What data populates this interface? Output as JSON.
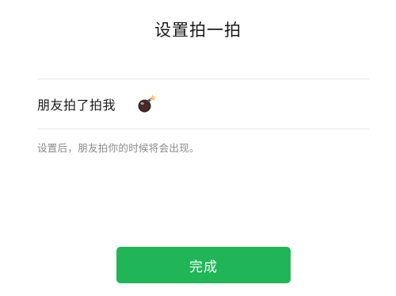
{
  "header": {
    "title": "设置拍一拍"
  },
  "pat_setting": {
    "prefix_label": "朋友拍了拍我",
    "suffix_icon": "bomb-icon",
    "hint": "设置后，朋友拍你的时候将会出现。"
  },
  "actions": {
    "done_label": "完成"
  },
  "colors": {
    "accent": "#20b658",
    "divider": "#e9e9e9",
    "hint_text": "#8a8a8a",
    "title_text": "#1a1a1a"
  }
}
